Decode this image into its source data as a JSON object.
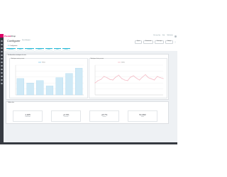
{
  "brand": {
    "part1": "Presta",
    "part2": "Shop"
  },
  "top_links": [
    "View my shop",
    "Help",
    "Notifications"
  ],
  "page": {
    "title": "Configurer",
    "breadcrumb": "Stats & Analytics"
  },
  "header_buttons": [
    "Export",
    "Refresh data",
    "Date range",
    "Settings"
  ],
  "tabs_title": "Configuration",
  "tabs": [
    "Dashboard",
    "Sales",
    "Customers",
    "Products",
    "Orders",
    "Traffic",
    "Settings"
  ],
  "colors": {
    "accent": "#25b9d7",
    "brand": "#df0067",
    "bar": "#cfe9f6",
    "line": "#f1a6b4",
    "sidebar": "#363a41"
  },
  "section1": {
    "title": "Dashboard des statistiques de vente"
  },
  "chart_data": [
    {
      "type": "bar",
      "title": "Statistiques ventes par mois",
      "categories": [
        "1",
        "2",
        "3",
        "4",
        "5",
        "6",
        "7"
      ],
      "series": [
        {
          "name": "Ventes",
          "values": [
            55,
            40,
            48,
            30,
            58,
            72,
            90
          ]
        }
      ],
      "ylim": [
        0,
        100
      ],
      "legend": "top",
      "grid": true
    },
    {
      "type": "line",
      "title": "Statistiques clients par mois",
      "categories": [
        "1",
        "2",
        "3",
        "4",
        "5",
        "6",
        "7",
        "8",
        "9",
        "10",
        "11",
        "12",
        "13",
        "14",
        "15",
        "16",
        "17",
        "18",
        "19",
        "20",
        "21",
        "22",
        "23",
        "24"
      ],
      "series": [
        {
          "name": "Clients",
          "values": [
            40,
            48,
            52,
            62,
            58,
            52,
            50,
            60,
            66,
            55,
            50,
            48,
            60,
            64,
            56,
            50,
            60,
            68,
            58,
            54,
            50,
            62,
            58,
            55
          ]
        }
      ],
      "ylim": [
        0,
        100
      ],
      "legend": "top",
      "grid": true
    }
  ],
  "section2": {
    "title": "Chiffres clés",
    "stats": [
      {
        "value": "1,325",
        "label": "Commandes"
      },
      {
        "value": "+2.3%",
        "label": "Conversion"
      },
      {
        "value": "+8.7%",
        "label": "Visiteurs"
      },
      {
        "value": "51,993",
        "label": "Ventes"
      }
    ]
  }
}
